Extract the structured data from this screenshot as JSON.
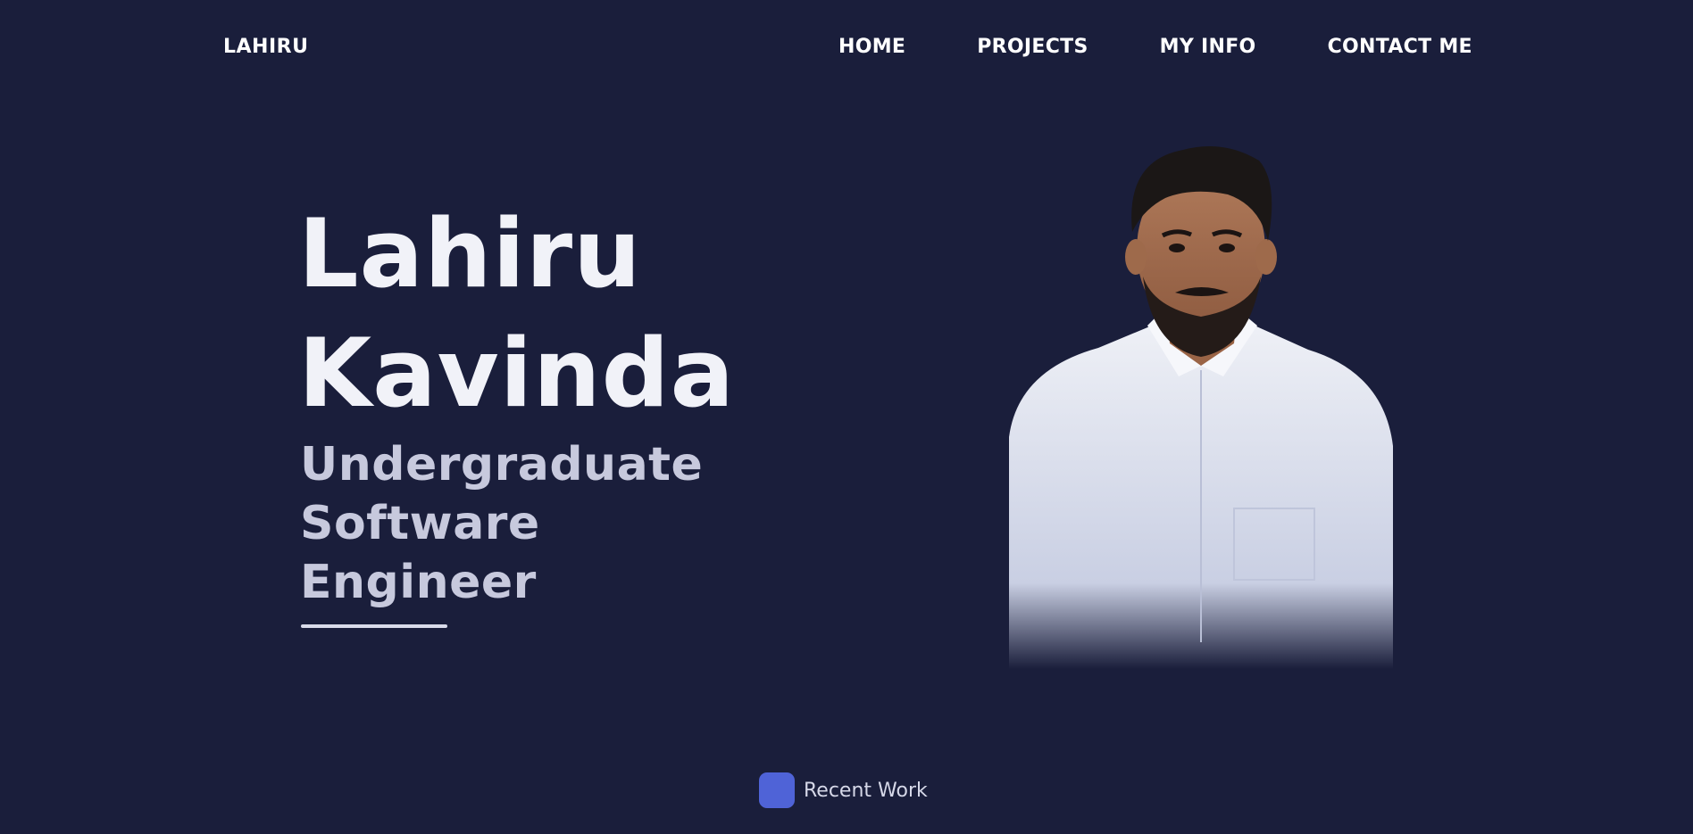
{
  "brand": {
    "logo": "LAHIRU"
  },
  "nav": {
    "items": [
      "HOME",
      "PROJECTS",
      "MY INFO",
      "CONTACT ME"
    ]
  },
  "hero": {
    "first_name": "Lahiru",
    "last_name": "Kavinda",
    "role_lines": [
      "Undergraduate",
      "Software",
      "Engineer"
    ]
  },
  "recent_work": {
    "label": "Recent Work"
  },
  "colors": {
    "background": "#1a1e3b",
    "accent": "#4f63d7",
    "text": "#f1f2f8",
    "muted_text": "#c7c9dd"
  }
}
